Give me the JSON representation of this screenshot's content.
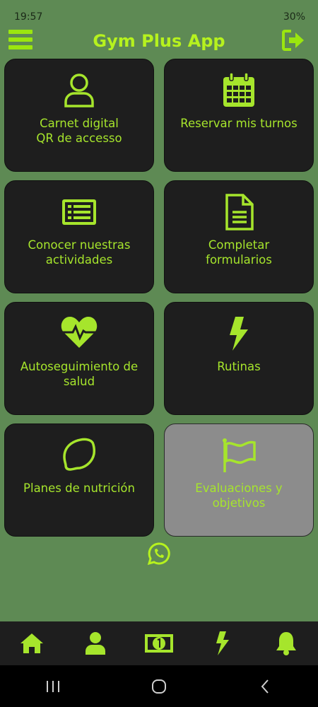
{
  "status_bar": {
    "time": "19:57",
    "battery": "30%"
  },
  "app": {
    "title": "Gym Plus App"
  },
  "cards": [
    {
      "label_line1": "Carnet digital",
      "label_line2": "QR de accesso",
      "icon": "user-icon",
      "enabled": true
    },
    {
      "label_line1": "Reservar mis turnos",
      "label_line2": "",
      "icon": "calendar-icon",
      "enabled": true
    },
    {
      "label_line1": "Conocer nuestras",
      "label_line2": "actividades",
      "icon": "list-card-icon",
      "enabled": true
    },
    {
      "label_line1": "Completar",
      "label_line2": "formularios",
      "icon": "document-icon",
      "enabled": true
    },
    {
      "label_line1": "Autoseguimiento de",
      "label_line2": "salud",
      "icon": "heartbeat-icon",
      "enabled": true
    },
    {
      "label_line1": "Rutinas",
      "label_line2": "",
      "icon": "lightning-icon",
      "enabled": true
    },
    {
      "label_line1": "Planes de nutrición",
      "label_line2": "",
      "icon": "lemon-icon",
      "enabled": true
    },
    {
      "label_line1": "Evaluaciones y",
      "label_line2": "objetivos",
      "icon": "flag-icon",
      "enabled": false
    }
  ],
  "colors": {
    "accent": "#a6e52c",
    "background": "#5e8a54",
    "card": "#1e1e1e",
    "disabled_card": "#8c8c8c"
  },
  "bottom_nav": [
    "home-icon",
    "profile-icon",
    "money-icon",
    "lightning-icon",
    "bell-icon"
  ]
}
